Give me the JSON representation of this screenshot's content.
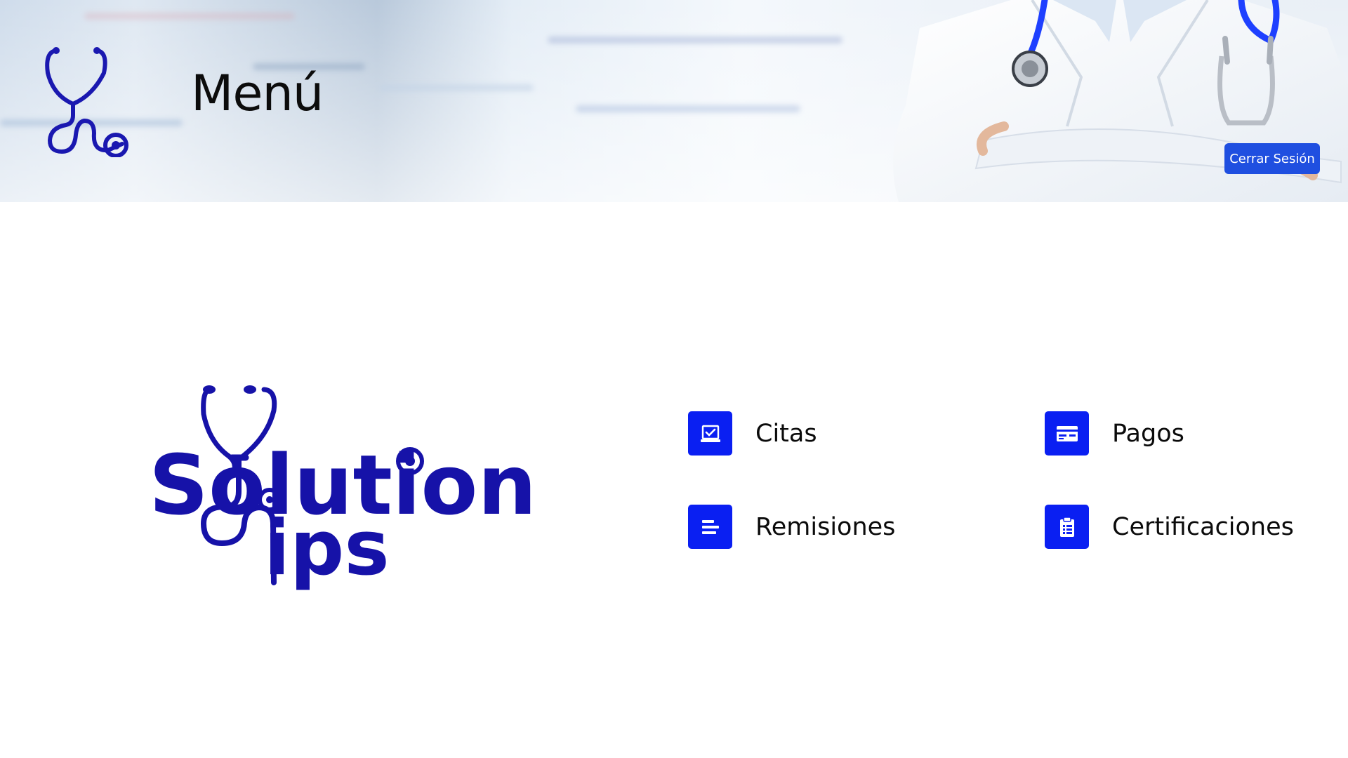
{
  "header": {
    "title": "Menú",
    "logout_label": "Cerrar Sesión"
  },
  "brand": {
    "logo_text_top": "Solution",
    "logo_text_bottom": "ips"
  },
  "menu": {
    "items": [
      {
        "label": "Citas",
        "icon": "calendar-check-icon"
      },
      {
        "label": "Pagos",
        "icon": "credit-card-icon"
      },
      {
        "label": "Remisiones",
        "icon": "lines-document-icon"
      },
      {
        "label": "Certificaciones",
        "icon": "clipboard-list-icon"
      }
    ]
  },
  "colors": {
    "primary": "#0a1ff2",
    "logo_blue": "#1612a8",
    "button": "#1f4fe0",
    "text": "#0b0b0b"
  }
}
